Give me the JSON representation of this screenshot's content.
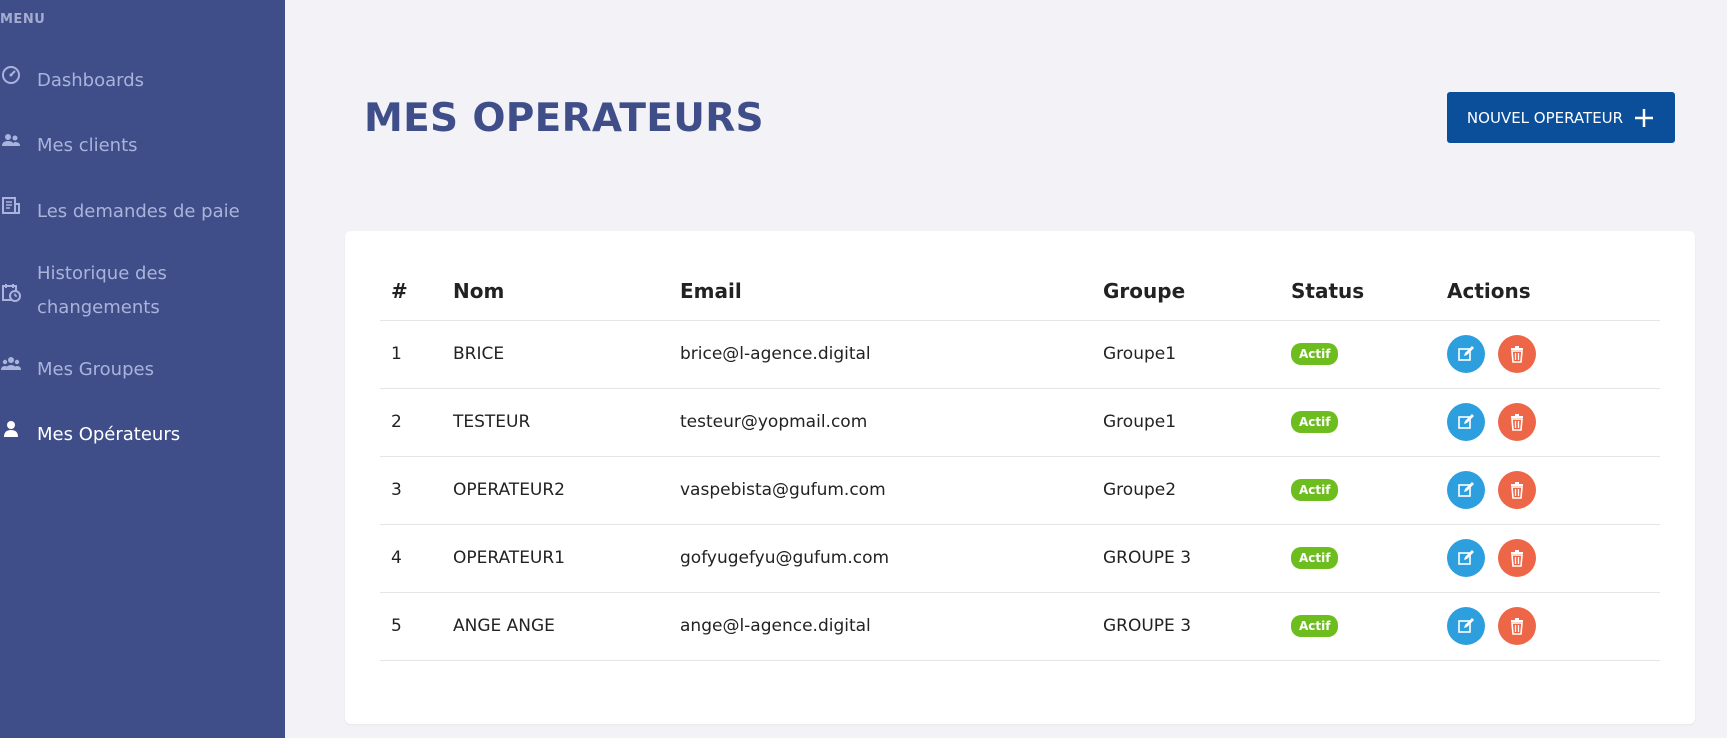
{
  "sidebar": {
    "menu_heading": "MENU",
    "items": [
      {
        "label": "Dashboards",
        "icon": "dashboard-icon"
      },
      {
        "label": "Mes clients",
        "icon": "users-icon"
      },
      {
        "label": "Les demandes de paie",
        "icon": "document-icon"
      },
      {
        "label": "Historique des changements",
        "icon": "history-icon"
      },
      {
        "label": "Mes Groupes",
        "icon": "group-icon"
      },
      {
        "label": "Mes Opérateurs",
        "icon": "user-icon",
        "active": true
      }
    ]
  },
  "header": {
    "title": "MES OPERATEURS",
    "new_button_label": "NOUVEL OPERATEUR"
  },
  "table": {
    "columns": [
      "#",
      "Nom",
      "Email",
      "Groupe",
      "Status",
      "Actions"
    ],
    "rows": [
      {
        "num": "1",
        "nom": "BRICE",
        "email": "brice@l-agence.digital",
        "groupe": "Groupe1",
        "status": "Actif"
      },
      {
        "num": "2",
        "nom": "TESTEUR",
        "email": "testeur@yopmail.com",
        "groupe": "Groupe1",
        "status": "Actif"
      },
      {
        "num": "3",
        "nom": "OPERATEUR2",
        "email": "vaspebista@gufum.com",
        "groupe": "Groupe2",
        "status": "Actif"
      },
      {
        "num": "4",
        "nom": "OPERATEUR1",
        "email": "gofyugefyu@gufum.com",
        "groupe": "GROUPE 3",
        "status": "Actif"
      },
      {
        "num": "5",
        "nom": "ANGE ANGE",
        "email": "ange@l-agence.digital",
        "groupe": "GROUPE 3",
        "status": "Actif"
      }
    ]
  },
  "colors": {
    "sidebar_bg": "#3f4e89",
    "title": "#3f4e89",
    "primary_button": "#0b4f9b",
    "status_active": "#6ebd1e",
    "edit": "#2d9fde",
    "delete": "#ed6647"
  }
}
